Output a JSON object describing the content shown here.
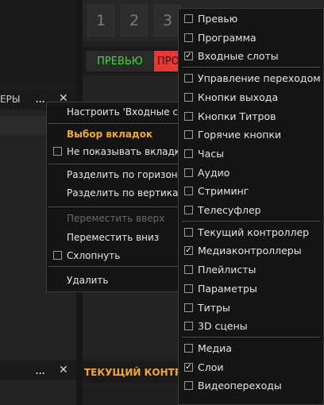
{
  "numbers": [
    "1",
    "2",
    "3"
  ],
  "tabs": {
    "preview": "ПРЕВЬЮ",
    "program": "ПРО"
  },
  "panel_title": "ЕРЫ",
  "dots": "...",
  "close": "✕",
  "controller_title": "ТЕКУЩИЙ КОНТРО",
  "context_menu": {
    "items": [
      {
        "label": "Настроить 'Входные с",
        "state": "normal"
      },
      {
        "label": "Выбор вкладок",
        "state": "accent"
      },
      {
        "label": "Не показывать вкладк",
        "state": "checkbox",
        "checked": false
      },
      {
        "label": "Разделить по горизон",
        "state": "normal"
      },
      {
        "label": "Разделить по вертика",
        "state": "normal"
      },
      {
        "label": "Переместить вверх",
        "state": "disabled"
      },
      {
        "label": "Переместить вниз",
        "state": "normal"
      },
      {
        "label": "Схлопнуть",
        "state": "checkbox",
        "checked": false
      },
      {
        "label": "Удалить",
        "state": "normal"
      }
    ]
  },
  "panel_list": {
    "groups": [
      [
        {
          "label": "Превью",
          "checked": false
        },
        {
          "label": "Программа",
          "checked": false
        },
        {
          "label": "Входные слоты",
          "checked": true
        }
      ],
      [
        {
          "label": "Управление переходом",
          "checked": false
        },
        {
          "label": "Кнопки выхода",
          "checked": false
        },
        {
          "label": "Кнопки Титров",
          "checked": false
        },
        {
          "label": "Горячие кнопки",
          "checked": false
        },
        {
          "label": "Часы",
          "checked": false
        },
        {
          "label": "Аудио",
          "checked": false
        },
        {
          "label": "Стриминг",
          "checked": false
        },
        {
          "label": "Телесуфлер",
          "checked": false
        }
      ],
      [
        {
          "label": "Текущий контроллер",
          "checked": false
        },
        {
          "label": "Медиаконтроллеры",
          "checked": true
        },
        {
          "label": "Плейлисты",
          "checked": false
        },
        {
          "label": "Параметры",
          "checked": false
        },
        {
          "label": "Титры",
          "checked": false
        },
        {
          "label": "3D сцены",
          "checked": false
        }
      ],
      [
        {
          "label": "Медиа",
          "checked": false
        },
        {
          "label": "Слои",
          "checked": true
        },
        {
          "label": "Видеопереходы",
          "checked": false
        }
      ]
    ]
  }
}
